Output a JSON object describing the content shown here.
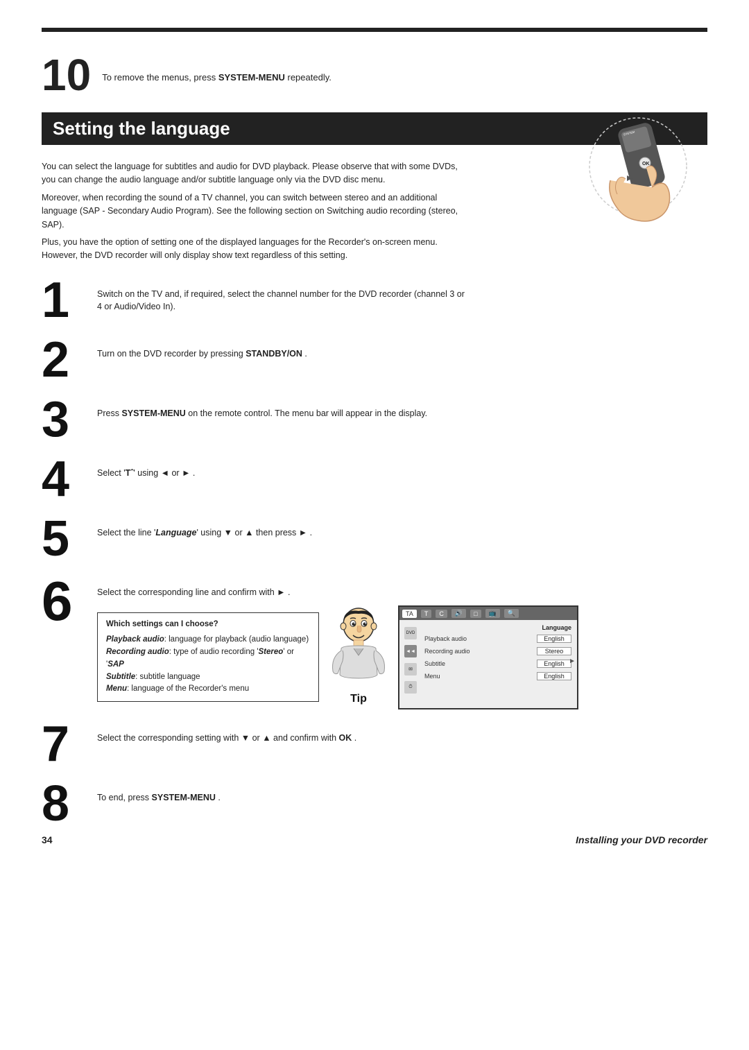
{
  "page": {
    "number": "34",
    "footer_title": "Installing your DVD recorder",
    "top_bar_visible": true
  },
  "step10": {
    "number": "10",
    "text": "To remove the menus, press ",
    "bold_text": "SYSTEM-MENU",
    "text_after": " repeatedly."
  },
  "section": {
    "title": "Setting the language"
  },
  "intro": {
    "para1": "You can select the language for subtitles and audio for DVD playback. Please observe that with some DVDs, you can change the audio language and/or subtitle language only via the DVD disc menu.",
    "para2": "Moreover, when recording the sound of a TV channel, you can switch between stereo and an additional language (SAP - Secondary Audio Program). See the following section on Switching audio recording (stereo, SAP).",
    "para3": "Plus, you have the option of setting one of the displayed languages for the Recorder's on-screen menu. However, the DVD recorder will only display show text regardless of this setting."
  },
  "steps": [
    {
      "number": "1",
      "text": "Switch on the TV and, if required, select the channel number for the DVD recorder (channel 3 or 4 or Audio/Video In)."
    },
    {
      "number": "2",
      "text": "Turn on the DVD recorder by pressing ",
      "bold": "STANDBY/ON",
      "text_after": " ."
    },
    {
      "number": "3",
      "text": "Press ",
      "bold": "SYSTEM-MENU",
      "text_after": " on the remote control. The menu bar will appear in the display."
    },
    {
      "number": "4",
      "text_before": "Select '",
      "symbol": "TA",
      "text_after": "' using ◄ or ► ."
    },
    {
      "number": "5",
      "text_before": "Select the line '",
      "italic_bold": "Language",
      "text_after": "' using ▼ or ▲ then press ► ."
    },
    {
      "number": "6",
      "text": "Select the corresponding line and confirm with ► ."
    },
    {
      "number": "7",
      "text_before": "Select the corresponding setting with ▼ or ▲ and confirm with ",
      "bold": "OK",
      "text_after": " ."
    },
    {
      "number": "8",
      "text_before": "To end, press ",
      "bold": "SYSTEM-MENU",
      "text_after": " ."
    }
  ],
  "which_settings": {
    "title": "Which settings can I choose?",
    "items": [
      {
        "bold_italic": "Playback audio",
        "text": ": language for playback (audio language)"
      },
      {
        "bold_italic": "Recording audio",
        "text": ": type of audio recording '",
        "italic_bold2": "Stereo",
        "text2": "' or '",
        "italic_bold3": "SAP"
      },
      {
        "bold_italic": "Subtitle",
        "text": ": subtitle language"
      },
      {
        "bold_italic": "Menu",
        "text": ": language of the Recorder's menu"
      }
    ]
  },
  "tip": {
    "label": "Tip"
  },
  "menu_screenshot": {
    "tabs": [
      "TA",
      "T",
      "C",
      "🔊",
      "□",
      "📺",
      "🔍"
    ],
    "active_tab": 0,
    "header_label": "Language",
    "rows": [
      {
        "label": "Playback audio",
        "value": "English"
      },
      {
        "label": "Recording audio",
        "value": "Stereo"
      },
      {
        "label": "Subtitle",
        "value": "English"
      },
      {
        "label": "Menu",
        "value": "English"
      }
    ]
  }
}
